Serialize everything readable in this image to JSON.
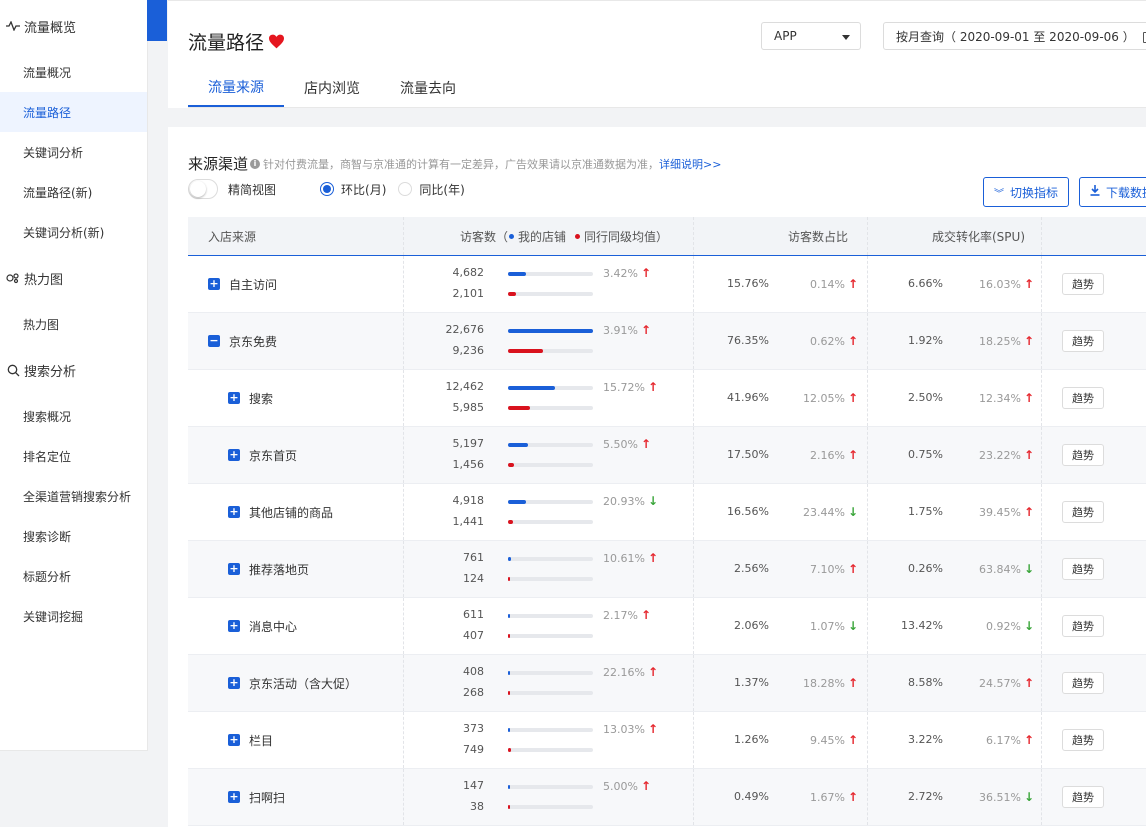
{
  "sidebar": {
    "groups": [
      {
        "title": "流量概览",
        "icon": "pulse-icon",
        "items": [
          "流量概况",
          "流量路径",
          "关键词分析",
          "流量路径(新)",
          "关键词分析(新)"
        ]
      },
      {
        "title": "热力图",
        "icon": "heatmap-icon",
        "items": [
          "热力图"
        ]
      },
      {
        "title": "搜索分析",
        "icon": "search-icon",
        "items": [
          "搜索概况",
          "排名定位",
          "全渠道营销搜索分析",
          "搜索诊断",
          "标题分析",
          "关键词挖掘"
        ]
      }
    ],
    "active_item": "流量路径"
  },
  "header": {
    "title": "流量路径",
    "platform_select": "APP",
    "date_query": "按月查询（ 2020-09-01 至 2020-09-06 ）",
    "tabs": [
      "流量来源",
      "店内浏览",
      "流量去向"
    ],
    "active_tab": "流量来源"
  },
  "section": {
    "title": "来源渠道",
    "note": "针对付费流量，商智与京准通的计算有一定差异，广告效果请以京准通数据为准，",
    "detail_link": "详细说明>>",
    "toggle_label": "精简视图",
    "radio_mom": "环比(月)",
    "radio_yoy": "同比(年)",
    "switch_btn": "切换指标",
    "download_btn": "下载数据"
  },
  "table": {
    "headers": {
      "source": "入店来源",
      "visitors": "访客数（",
      "my_shop": "我的店铺",
      "peer_avg": "同行同级均值",
      "visitors_end": "）",
      "share": "访客数占比",
      "conv": "成交转化率(SPU)"
    },
    "trend_label": "趋势",
    "max_visitors": 22676,
    "rows": [
      {
        "name": "自主访问",
        "level": 0,
        "expand": "+",
        "my": "4,682",
        "my_v": 4682,
        "peer": "2,101",
        "peer_v": 2101,
        "pct": "3.42%",
        "pct_dir": "up",
        "share": "15.76%",
        "share_chg": "0.14%",
        "share_dir": "up",
        "conv": "6.66%",
        "conv_chg": "16.03%",
        "conv_dir": "up"
      },
      {
        "name": "京东免费",
        "level": 0,
        "expand": "−",
        "my": "22,676",
        "my_v": 22676,
        "peer": "9,236",
        "peer_v": 9236,
        "pct": "3.91%",
        "pct_dir": "up",
        "share": "76.35%",
        "share_chg": "0.62%",
        "share_dir": "up",
        "conv": "1.92%",
        "conv_chg": "18.25%",
        "conv_dir": "up"
      },
      {
        "name": "搜索",
        "level": 1,
        "expand": "+",
        "my": "12,462",
        "my_v": 12462,
        "peer": "5,985",
        "peer_v": 5985,
        "pct": "15.72%",
        "pct_dir": "up",
        "share": "41.96%",
        "share_chg": "12.05%",
        "share_dir": "up",
        "conv": "2.50%",
        "conv_chg": "12.34%",
        "conv_dir": "up"
      },
      {
        "name": "京东首页",
        "level": 1,
        "expand": "+",
        "my": "5,197",
        "my_v": 5197,
        "peer": "1,456",
        "peer_v": 1456,
        "pct": "5.50%",
        "pct_dir": "up",
        "share": "17.50%",
        "share_chg": "2.16%",
        "share_dir": "up",
        "conv": "0.75%",
        "conv_chg": "23.22%",
        "conv_dir": "up"
      },
      {
        "name": "其他店铺的商品",
        "level": 1,
        "expand": "+",
        "my": "4,918",
        "my_v": 4918,
        "peer": "1,441",
        "peer_v": 1441,
        "pct": "20.93%",
        "pct_dir": "down",
        "share": "16.56%",
        "share_chg": "23.44%",
        "share_dir": "down",
        "conv": "1.75%",
        "conv_chg": "39.45%",
        "conv_dir": "up"
      },
      {
        "name": "推荐落地页",
        "level": 1,
        "expand": "+",
        "my": "761",
        "my_v": 761,
        "peer": "124",
        "peer_v": 124,
        "pct": "10.61%",
        "pct_dir": "up",
        "share": "2.56%",
        "share_chg": "7.10%",
        "share_dir": "up",
        "conv": "0.26%",
        "conv_chg": "63.84%",
        "conv_dir": "down"
      },
      {
        "name": "消息中心",
        "level": 1,
        "expand": "+",
        "my": "611",
        "my_v": 611,
        "peer": "407",
        "peer_v": 407,
        "pct": "2.17%",
        "pct_dir": "up",
        "share": "2.06%",
        "share_chg": "1.07%",
        "share_dir": "down",
        "conv": "13.42%",
        "conv_chg": "0.92%",
        "conv_dir": "down"
      },
      {
        "name": "京东活动（含大促）",
        "level": 1,
        "expand": "+",
        "my": "408",
        "my_v": 408,
        "peer": "268",
        "peer_v": 268,
        "pct": "22.16%",
        "pct_dir": "up",
        "share": "1.37%",
        "share_chg": "18.28%",
        "share_dir": "up",
        "conv": "8.58%",
        "conv_chg": "24.57%",
        "conv_dir": "up"
      },
      {
        "name": "栏目",
        "level": 1,
        "expand": "+",
        "my": "373",
        "my_v": 373,
        "peer": "749",
        "peer_v": 749,
        "pct": "13.03%",
        "pct_dir": "up",
        "share": "1.26%",
        "share_chg": "9.45%",
        "share_dir": "up",
        "conv": "3.22%",
        "conv_chg": "6.17%",
        "conv_dir": "up"
      },
      {
        "name": "扫啊扫",
        "level": 1,
        "expand": "+",
        "my": "147",
        "my_v": 147,
        "peer": "38",
        "peer_v": 38,
        "pct": "5.00%",
        "pct_dir": "up",
        "share": "0.49%",
        "share_chg": "1.67%",
        "share_dir": "up",
        "conv": "2.72%",
        "conv_chg": "36.51%",
        "conv_dir": "down"
      }
    ]
  },
  "colors": {
    "accent": "#1a5fd8",
    "peer": "#d9121e",
    "up": "#e5262d",
    "down": "#3aa53a"
  }
}
